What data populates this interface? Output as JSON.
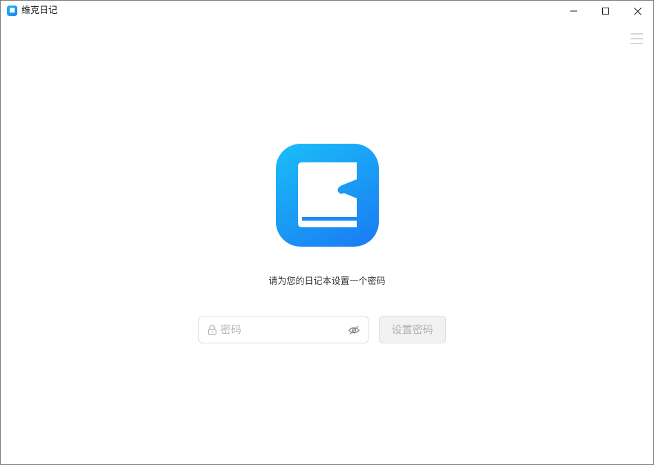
{
  "window": {
    "title": "维克日记",
    "controls": {
      "minimize": "minimize-icon",
      "maximize": "maximize-icon",
      "close": "close-icon"
    }
  },
  "toolbar": {
    "menu_icon": "hamburger-menu-icon"
  },
  "main": {
    "logo_icon": "diary-book-logo-icon",
    "prompt": "请为您的日记本设置一个密码",
    "password": {
      "value": "",
      "placeholder": "密码",
      "lock_icon": "lock-icon",
      "visibility_icon": "eye-hidden-icon"
    },
    "submit_label": "设置密码"
  },
  "colors": {
    "brand_blue_light": "#1ab6f7",
    "brand_blue_dark": "#1a82f3",
    "button_disabled_bg": "#f2f2f2",
    "button_disabled_text": "#b0b0b0",
    "input_border": "#dcdcdc"
  }
}
